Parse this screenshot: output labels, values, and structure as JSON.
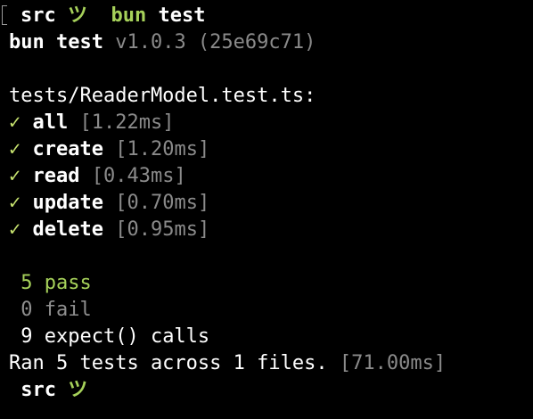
{
  "colors": {
    "background": "#000000",
    "text": "#ffffff",
    "dim": "#8a8a8a",
    "pass_green": "#a6d15a",
    "check_green": "#c7e36f"
  },
  "prompt": {
    "dir": "src",
    "symbol": "ツ",
    "command": "bun",
    "args": "test"
  },
  "header": {
    "title": "bun test",
    "version": "v1.0.3 (25e69c71)"
  },
  "file": "tests/ReaderModel.test.ts:",
  "tests": [
    {
      "mark": "✓",
      "name": "all",
      "time": "[1.22ms]"
    },
    {
      "mark": "✓",
      "name": "create",
      "time": "[1.20ms]"
    },
    {
      "mark": "✓",
      "name": "read",
      "time": "[0.43ms]"
    },
    {
      "mark": "✓",
      "name": "update",
      "time": "[0.70ms]"
    },
    {
      "mark": "✓",
      "name": "delete",
      "time": "[0.95ms]"
    }
  ],
  "summary": {
    "pass": "5 pass",
    "fail": "0 fail",
    "expects": "9 expect() calls",
    "ran": "Ran 5 tests across 1 files.",
    "ran_time": "[71.00ms]"
  },
  "end_prompt": {
    "dir": "src",
    "symbol": "ツ"
  }
}
